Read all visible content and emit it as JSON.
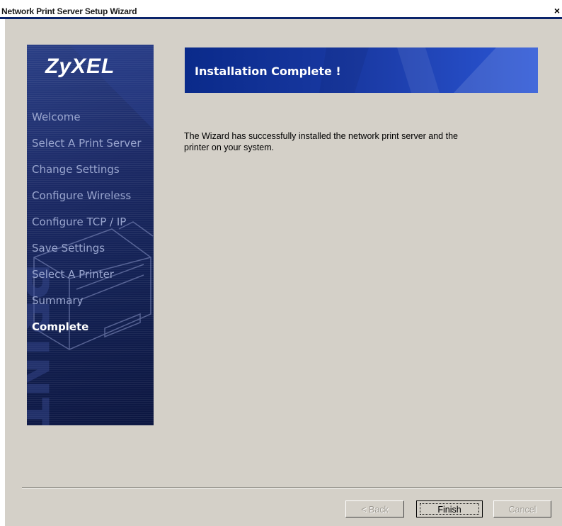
{
  "window": {
    "title": "Network Print Server Setup Wizard",
    "close_glyph": "×"
  },
  "sidebar": {
    "logo": "ZyXEL",
    "steps": [
      {
        "label": "Welcome",
        "active": false
      },
      {
        "label": "Select A Print Server",
        "active": false
      },
      {
        "label": "Change Settings",
        "active": false
      },
      {
        "label": "Configure Wireless",
        "active": false
      },
      {
        "label": "Configure  TCP / IP",
        "active": false
      },
      {
        "label": "Save Settings",
        "active": false
      },
      {
        "label": "Select A Printer",
        "active": false
      },
      {
        "label": "Summary",
        "active": false
      },
      {
        "label": "Complete",
        "active": true
      }
    ]
  },
  "banner": {
    "title": "Installation Complete !"
  },
  "message": "The Wizard has successfully installed the network print server and the printer on your system.",
  "buttons": {
    "back": "< Back",
    "finish": "Finish",
    "cancel": "Cancel"
  },
  "colors": {
    "dialog_bg": "#d4d0c8",
    "banner": "#1a3aa4",
    "sidebar": "#1c2a66"
  }
}
